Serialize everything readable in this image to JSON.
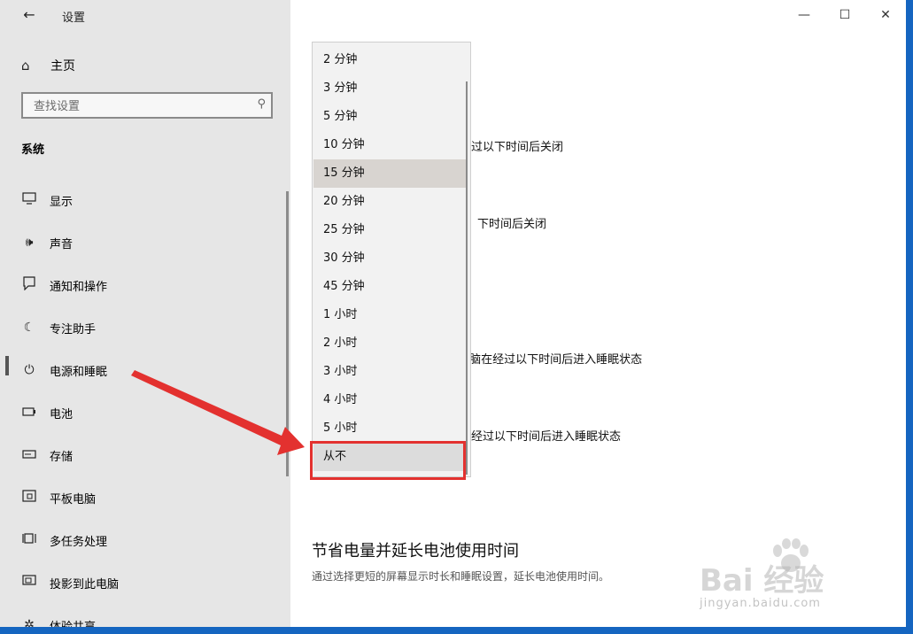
{
  "window": {
    "title": "设置",
    "back_icon": "arrow-left-icon",
    "controls": [
      "minimize",
      "maximize",
      "close"
    ]
  },
  "sidebar": {
    "home_label": "主页",
    "search_placeholder": "查找设置",
    "section_title": "系统",
    "items": [
      {
        "label": "显示",
        "icon": "monitor-icon"
      },
      {
        "label": "声音",
        "icon": "speaker-icon"
      },
      {
        "label": "通知和操作",
        "icon": "notification-icon"
      },
      {
        "label": "专注助手",
        "icon": "moon-icon"
      },
      {
        "label": "电源和睡眠",
        "icon": "power-icon",
        "active": true
      },
      {
        "label": "电池",
        "icon": "battery-icon"
      },
      {
        "label": "存储",
        "icon": "storage-icon"
      },
      {
        "label": "平板电脑",
        "icon": "tablet-icon"
      },
      {
        "label": "多任务处理",
        "icon": "multitask-icon"
      },
      {
        "label": "投影到此电脑",
        "icon": "project-icon"
      },
      {
        "label": "体验共享",
        "icon": "share-icon"
      }
    ]
  },
  "main": {
    "screen_battery_text": "过以下时间后关闭",
    "screen_plugged_text": "、下时间后关闭",
    "sleep_battery_text": ",脑在经过以下时间后进入睡眠状态",
    "sleep_plugged_text": "经过以下时间后进入睡眠状态",
    "heading": "节省电量并延长电池使用时间",
    "description": "通过选择更短的屏幕显示时长和睡眠设置，延长电池使用时间。"
  },
  "dropdown": {
    "options": [
      "2 分钟",
      "3 分钟",
      "5 分钟",
      "10 分钟",
      "15 分钟",
      "20 分钟",
      "25 分钟",
      "30 分钟",
      "45 分钟",
      "1 小时",
      "2 小时",
      "3 小时",
      "4 小时",
      "5 小时",
      "从不"
    ],
    "highlighted": "15 分钟",
    "selected": "从不"
  },
  "annotation": {
    "box_color": "#e3312f",
    "arrow_color": "#e3312f"
  },
  "watermark": {
    "brand": "Bai  经验",
    "url": "jingyan.baidu.com"
  }
}
